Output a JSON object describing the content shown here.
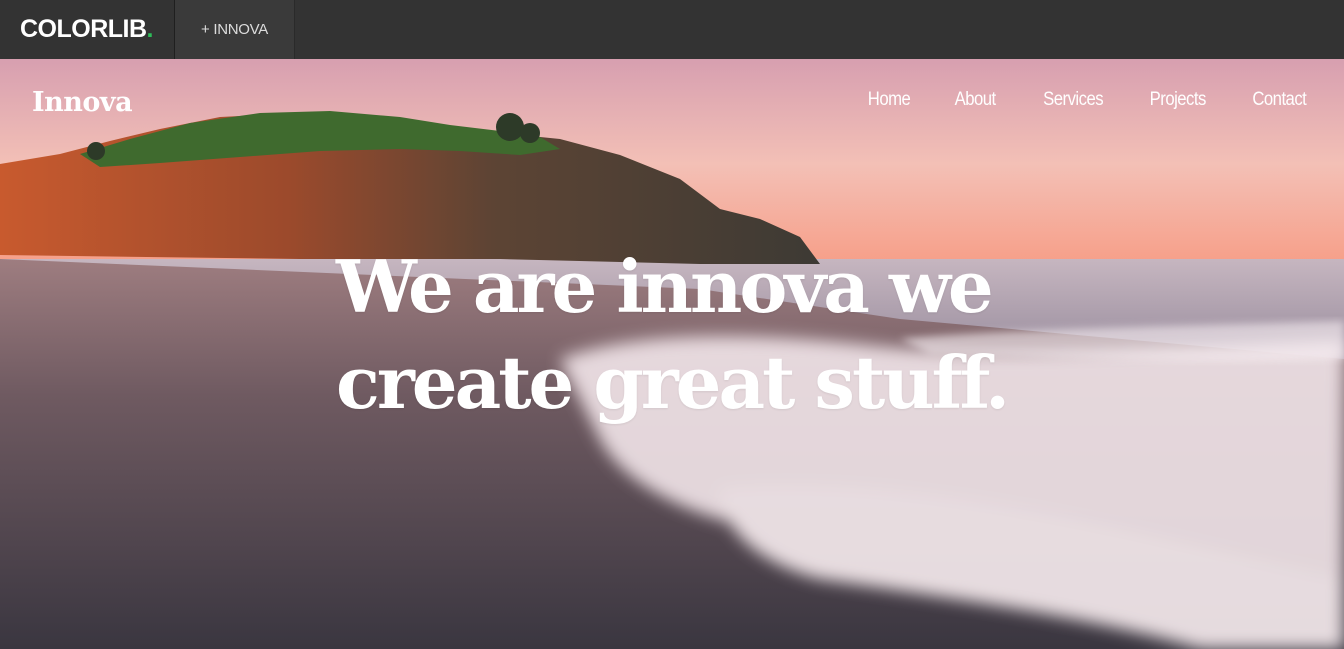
{
  "topbar": {
    "brand_name": "COLORLIB",
    "brand_dot": ".",
    "brand_dot_color": "#2ebd59",
    "theme_tab_label": "+ INNOVA"
  },
  "header": {
    "logo": "Innova",
    "nav": [
      {
        "label": "Home"
      },
      {
        "label": "About"
      },
      {
        "label": "Services"
      },
      {
        "label": "Projects"
      },
      {
        "label": "Contact"
      }
    ]
  },
  "hero": {
    "headline_line1": "We are innova we",
    "headline_line2": "create great stuff.",
    "background_image": "beach-sunset-photo"
  }
}
